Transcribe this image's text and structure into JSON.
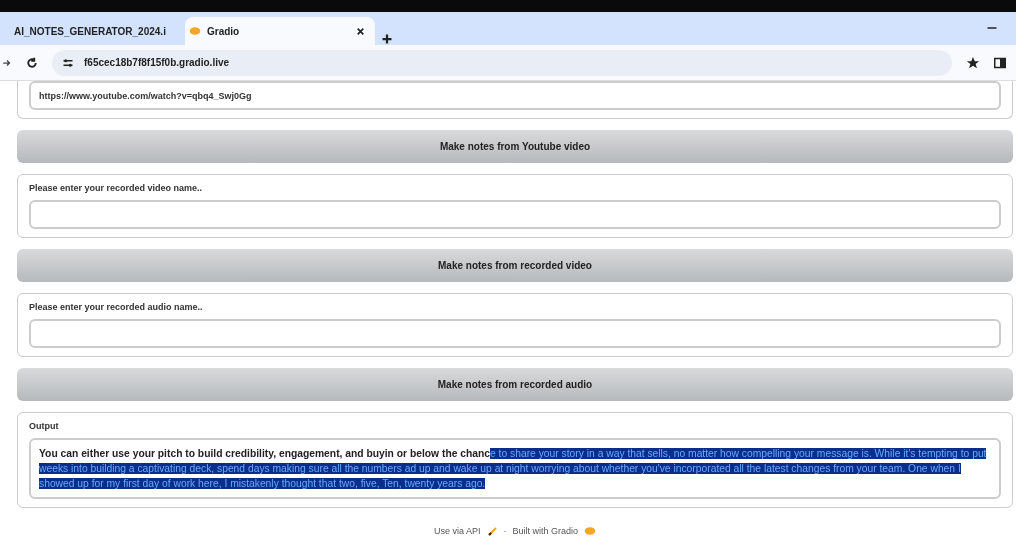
{
  "browser": {
    "tabs": [
      {
        "title": "AI_NOTES_GENERATOR_2024.i",
        "selected": false
      },
      {
        "title": "Gradio",
        "selected": true
      }
    ],
    "address": "f65cec18b7f8f15f0b.gradio.live"
  },
  "sections": [
    {
      "kind": "field_only",
      "value": "https://www.youtube.com/watch?v=qbq4_Swj0Gg",
      "button": "Make notes from Youtube video"
    },
    {
      "kind": "labeled",
      "label": "Please enter your recorded video name..",
      "button": "Make notes from recorded video"
    },
    {
      "kind": "labeled",
      "label": "Please enter your recorded audio name..",
      "button": "Make notes from recorded audio"
    }
  ],
  "output": {
    "label": "Output",
    "segments": [
      {
        "text": "You can either use your pitch to build credibility, engagement, and buyin or below the chanc",
        "selected": false
      },
      {
        "text": "e to share your story in a way that sells, no matter how compelling your message is. While it's tempting to put weeks into building a captivating deck, spend days making sure all the numbers ad up and wake up at night worrying about whether you've incorporated all the latest changes from your team. One when I showed up for my first day of work here, I mistakenly thought that two, five, Ten, twenty years ago.",
        "selected": true
      }
    ]
  },
  "footer": {
    "api": "Use via API",
    "separator": "·",
    "built": "Built with Gradio"
  }
}
